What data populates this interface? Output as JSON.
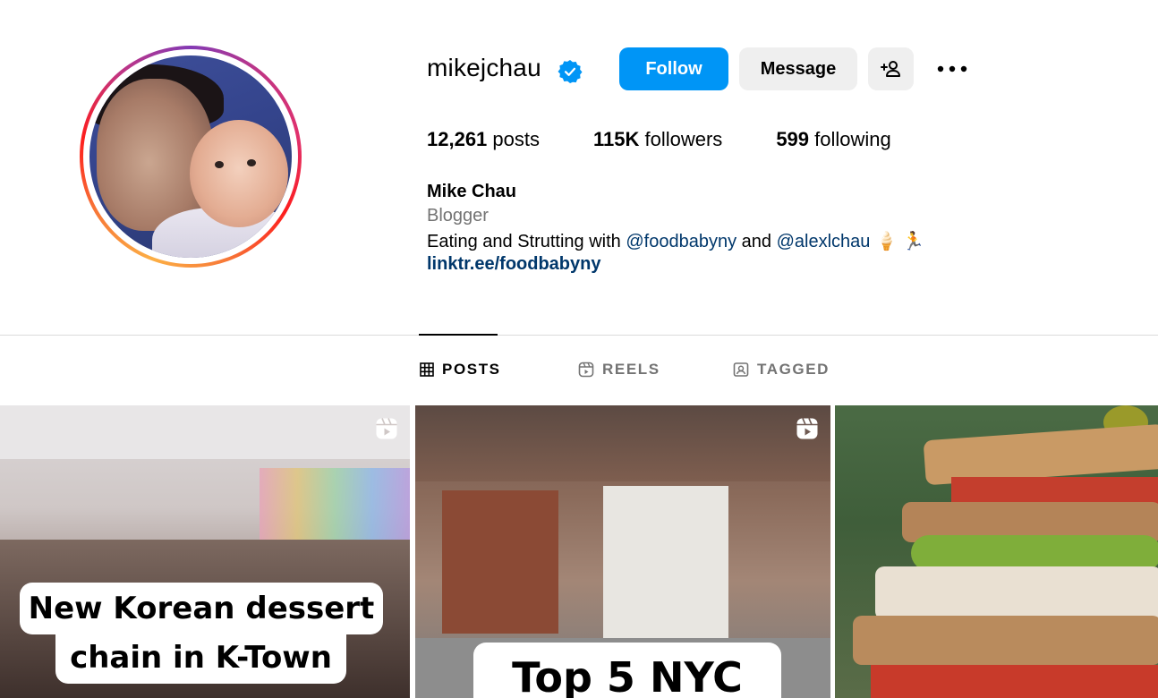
{
  "profile": {
    "username": "mikejchau",
    "verified_icon": "verified-badge-icon",
    "full_name": "Mike Chau",
    "category": "Blogger",
    "bio_prefix": "Eating and Strutting with ",
    "mention_1": "@foodbabyny",
    "bio_middle": " and ",
    "mention_2": "@alexlchau",
    "bio_emoji": " 🍦 🏃",
    "link": "linktr.ee/foodbabyny"
  },
  "actions": {
    "follow_label": "Follow",
    "message_label": "Message",
    "add_user_icon": "add-user-icon",
    "more_icon": "more-options-icon"
  },
  "stats": [
    {
      "value": "12,261",
      "label": " posts"
    },
    {
      "value": "115K",
      "label": " followers"
    },
    {
      "value": "599",
      "label": " following"
    }
  ],
  "tabs": [
    {
      "label": "POSTS",
      "icon": "grid-icon",
      "active": true
    },
    {
      "label": "REELS",
      "icon": "reels-icon",
      "active": false
    },
    {
      "label": "TAGGED",
      "icon": "tagged-icon",
      "active": false
    }
  ],
  "posts": [
    {
      "caption_line1": "New Korean dessert",
      "caption_line2": "chain in K-Town",
      "type": "reel"
    },
    {
      "caption_line1": "Top 5 NYC",
      "type": "reel"
    },
    {
      "caption_line1": "",
      "type": "image"
    }
  ],
  "colors": {
    "accent": "#0095f6",
    "link": "#00376b",
    "muted": "#737373",
    "button_gray": "#efefef"
  }
}
